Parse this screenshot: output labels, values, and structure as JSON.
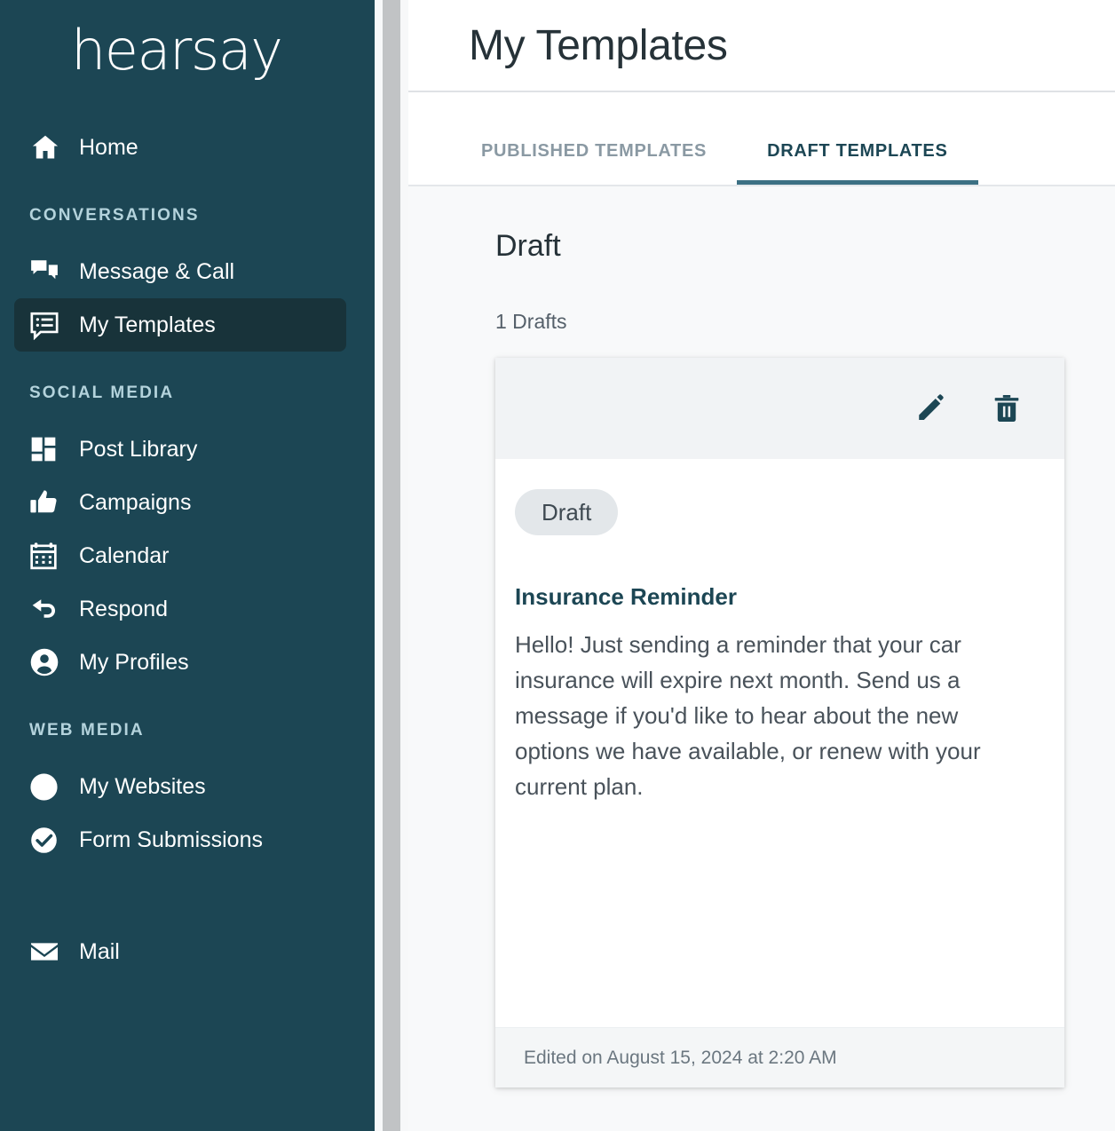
{
  "sidebar": {
    "brand": "hearsay",
    "home": {
      "label": "Home",
      "icon": "home-icon"
    },
    "sections": [
      {
        "label": "CONVERSATIONS",
        "items": [
          {
            "label": "Message & Call",
            "icon": "chat-bubbles-icon",
            "active": false
          },
          {
            "label": "My Templates",
            "icon": "template-message-icon",
            "active": true
          }
        ]
      },
      {
        "label": "SOCIAL MEDIA",
        "items": [
          {
            "label": "Post Library",
            "icon": "grid-blocks-icon",
            "active": false
          },
          {
            "label": "Campaigns",
            "icon": "thumbs-up-icon",
            "active": false
          },
          {
            "label": "Calendar",
            "icon": "calendar-icon",
            "active": false
          },
          {
            "label": "Respond",
            "icon": "reply-arrow-icon",
            "active": false
          },
          {
            "label": "My Profiles",
            "icon": "user-circle-icon",
            "active": false
          }
        ]
      },
      {
        "label": "WEB MEDIA",
        "items": [
          {
            "label": "My Websites",
            "icon": "globe-icon",
            "active": false
          },
          {
            "label": "Form Submissions",
            "icon": "check-circle-icon",
            "active": false
          }
        ]
      }
    ],
    "mail": {
      "label": "Mail",
      "icon": "envelope-icon"
    }
  },
  "header": {
    "title": "My Templates"
  },
  "tabs": [
    {
      "label": "PUBLISHED TEMPLATES",
      "active": false
    },
    {
      "label": "DRAFT TEMPLATES",
      "active": true
    }
  ],
  "main": {
    "section_title": "Draft",
    "count_text": "1 Drafts"
  },
  "card": {
    "edit_icon": "pencil-icon",
    "delete_icon": "trash-icon",
    "badge": "Draft",
    "title": "Insurance Reminder",
    "body": "Hello! Just sending a reminder that your car insurance will expire next month. Send us a message if you'd like to hear about the new options we have available, or renew with your current plan.",
    "footer": "Edited on August 15, 2024 at 2:20 AM"
  },
  "colors": {
    "sidebar_bg": "#1c4654",
    "sidebar_active_bg": "#18333a",
    "section_label": "#b4d3dc",
    "tab_active": "#1c4654",
    "tab_underline": "#3c7083",
    "tab_inactive": "#8a99a3",
    "card_title": "#1c4654",
    "badge_bg": "#e3e7ea",
    "page_bg": "#f8f9fa"
  }
}
